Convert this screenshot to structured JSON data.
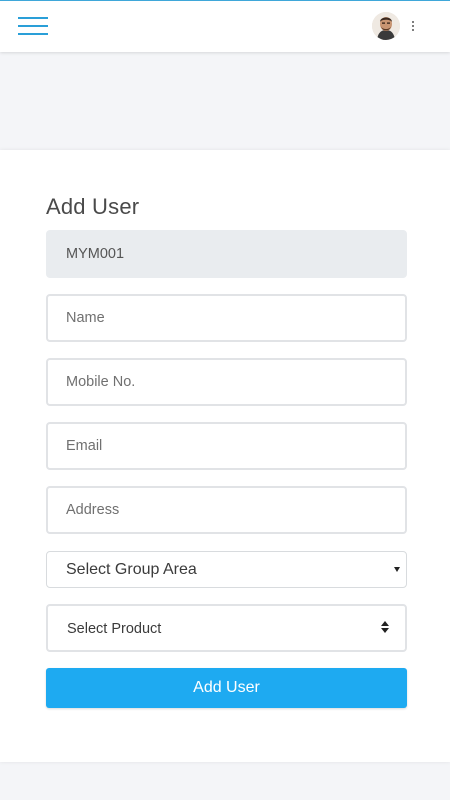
{
  "header": {
    "menu_icon": "hamburger-menu-icon",
    "avatar_icon": "user-avatar",
    "more_icon": "more-vertical-icon",
    "accent_color": "#2a9fd8"
  },
  "form": {
    "title": "Add User",
    "user_id_value": "MYM001",
    "name_placeholder": "Name",
    "mobile_placeholder": "Mobile No.",
    "email_placeholder": "Email",
    "address_placeholder": "Address",
    "group_area_selected": "Select Group Area",
    "product_selected": "Select Product",
    "submit_label": "Add User",
    "submit_color": "#1eaaf1"
  }
}
